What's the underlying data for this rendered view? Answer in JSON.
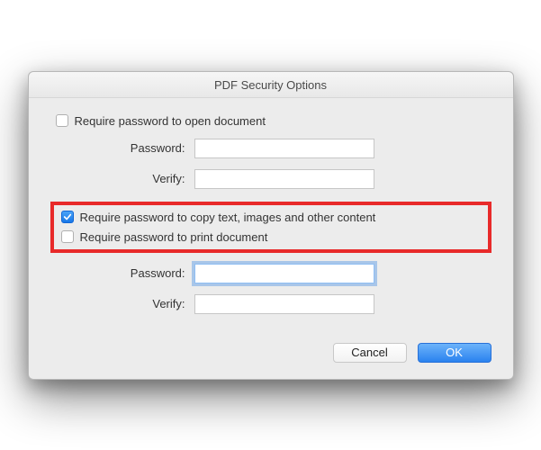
{
  "dialog": {
    "title": "PDF Security Options"
  },
  "section1": {
    "checkbox_label": "Require password to open document",
    "checked": false,
    "password_label": "Password:",
    "password_value": "",
    "verify_label": "Verify:",
    "verify_value": ""
  },
  "section2": {
    "copy_checkbox_label": "Require password to copy text, images and other content",
    "copy_checked": true,
    "print_checkbox_label": "Require password to print document",
    "print_checked": false,
    "password_label": "Password:",
    "password_value": "",
    "verify_label": "Verify:",
    "verify_value": ""
  },
  "buttons": {
    "cancel": "Cancel",
    "ok": "OK"
  },
  "highlight_color": "#e82a2a"
}
